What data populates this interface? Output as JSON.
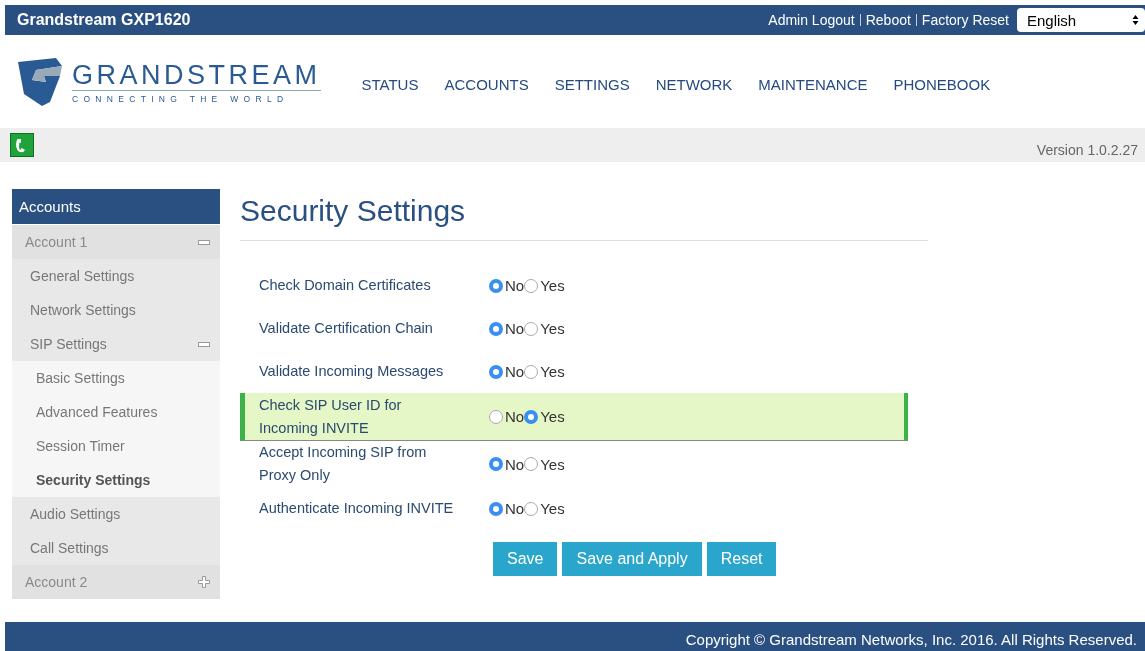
{
  "top_bar": {
    "title": "Grandstream GXP1620",
    "links": [
      "Admin Logout",
      "Reboot",
      "Factory Reset"
    ],
    "language": "English"
  },
  "header": {
    "logo_name": "GRANDSTREAM",
    "logo_tagline": "CONNECTING THE WORLD",
    "nav": [
      {
        "label": "STATUS",
        "selected": false
      },
      {
        "label": "ACCOUNTS",
        "selected": false
      },
      {
        "label": "SETTINGS",
        "selected": false
      },
      {
        "label": "NETWORK",
        "selected": false
      },
      {
        "label": "MAINTENANCE",
        "selected": false
      },
      {
        "label": "PHONEBOOK",
        "selected": false
      }
    ]
  },
  "info_bar": {
    "version": "Version 1.0.2.27"
  },
  "sidebar": {
    "title": "Accounts",
    "items": [
      {
        "label": "Account 1",
        "expanded": true,
        "selected": false,
        "children": [
          {
            "label": "General Settings",
            "selected": false
          },
          {
            "label": "Network Settings",
            "selected": false
          },
          {
            "label": "SIP Settings",
            "expanded": true,
            "selected": false,
            "children": [
              {
                "label": "Basic Settings",
                "selected": false
              },
              {
                "label": "Advanced Features",
                "selected": false
              },
              {
                "label": "Session Timer",
                "selected": false
              },
              {
                "label": "Security Settings",
                "selected": true
              }
            ]
          },
          {
            "label": "Audio Settings",
            "selected": false
          },
          {
            "label": "Call Settings",
            "selected": false
          }
        ]
      },
      {
        "label": "Account 2",
        "expanded": false,
        "selected": false
      }
    ]
  },
  "page": {
    "title": "Security Settings",
    "settings": [
      {
        "label": "Check Domain Certificates",
        "highlighted": false,
        "options": [
          {
            "label": "No",
            "selected": true
          },
          {
            "label": "Yes",
            "selected": false
          }
        ]
      },
      {
        "label": "Validate Certification Chain",
        "highlighted": false,
        "options": [
          {
            "label": "No",
            "selected": true
          },
          {
            "label": "Yes",
            "selected": false
          }
        ]
      },
      {
        "label": "Validate Incoming Messages",
        "highlighted": false,
        "options": [
          {
            "label": "No",
            "selected": true
          },
          {
            "label": "Yes",
            "selected": false
          }
        ]
      },
      {
        "label": "Check SIP User ID for Incoming INVITE",
        "highlighted": true,
        "options": [
          {
            "label": "No",
            "selected": false
          },
          {
            "label": "Yes",
            "selected": true
          }
        ]
      },
      {
        "label": "Accept Incoming SIP from Proxy Only",
        "highlighted": false,
        "options": [
          {
            "label": "No",
            "selected": true
          },
          {
            "label": "Yes",
            "selected": false
          }
        ]
      },
      {
        "label": "Authenticate Incoming INVITE",
        "highlighted": false,
        "options": [
          {
            "label": "No",
            "selected": true
          },
          {
            "label": "Yes",
            "selected": false
          }
        ]
      }
    ],
    "buttons": [
      "Save",
      "Save and Apply",
      "Reset"
    ]
  },
  "footer": {
    "copyright": "Copyright © Grandstream Networks, Inc. 2016. All Rights Reserved."
  }
}
